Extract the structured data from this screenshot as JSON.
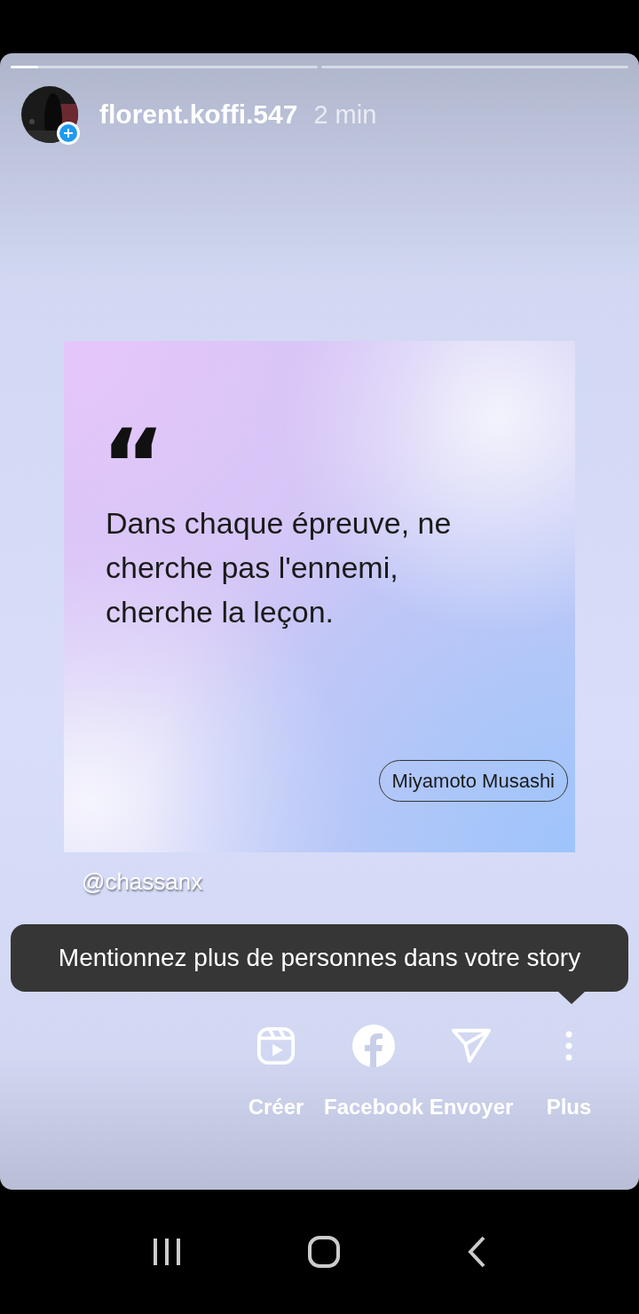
{
  "progress": [
    {
      "level": 0.09
    },
    {
      "level": 0
    }
  ],
  "header": {
    "username": "florent.koffi.547",
    "time": "2 min"
  },
  "quote_card": {
    "mark": "“",
    "text": "Dans chaque épreuve, ne cherche pas l'ennemi, cherche la leçon.",
    "author": "Miyamoto Musashi"
  },
  "mention": "@chassanx",
  "tooltip": "Mentionnez plus de personnes dans votre story",
  "actions": [
    {
      "kind": "create",
      "label": "Créer"
    },
    {
      "kind": "facebook",
      "label": "Facebook"
    },
    {
      "kind": "send",
      "label": "Envoyer"
    },
    {
      "kind": "more",
      "label": "Plus"
    }
  ],
  "nav": [
    {
      "kind": "recents"
    },
    {
      "kind": "home"
    },
    {
      "kind": "back"
    }
  ]
}
